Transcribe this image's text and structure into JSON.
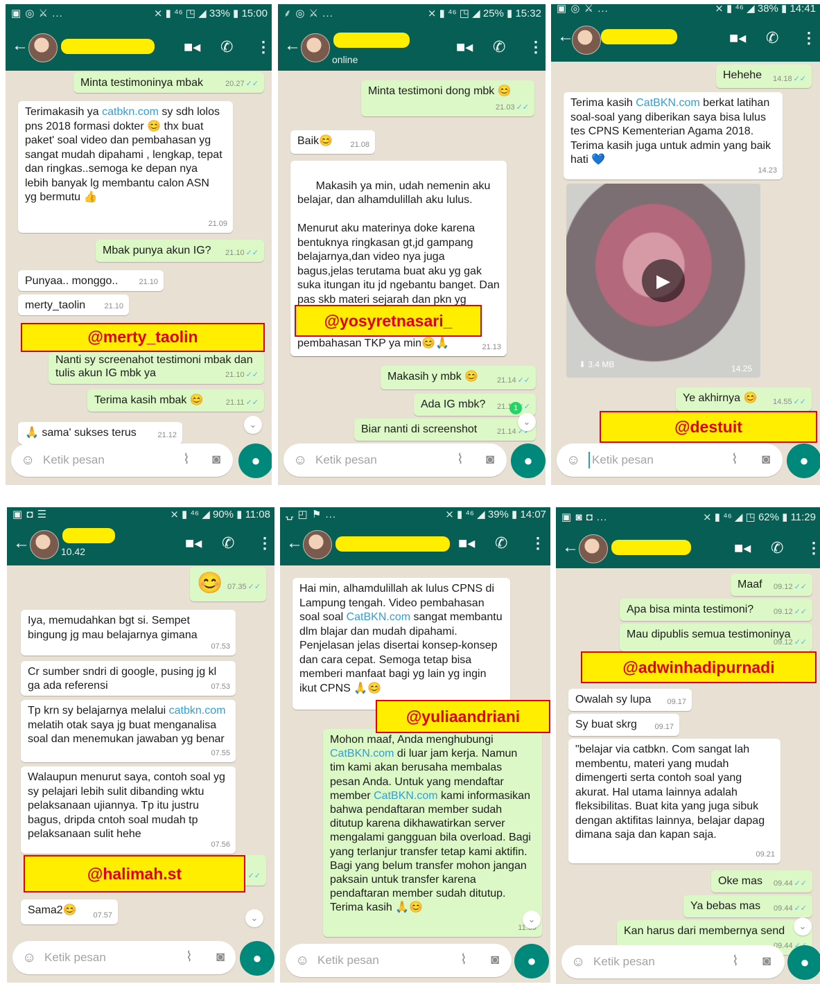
{
  "common": {
    "input_placeholder": "Ketik pesan",
    "icons": {
      "back": "arrow-left-icon",
      "video": "video-call-icon",
      "call": "phone-icon",
      "menu": "more-vert-icon",
      "emoji": "emoji-icon",
      "attach": "paperclip-icon",
      "camera": "camera-icon",
      "mic": "mic-icon",
      "scroll": "chevron-down-icon"
    },
    "colors": {
      "header": "#075e54",
      "chat_bg": "#e8e0d3",
      "outgoing_bubble": "#dcf8c6",
      "incoming_bubble": "#ffffff",
      "label_fill": "#ffee00",
      "label_border": "#e00010",
      "link": "#2f9fd8",
      "read_ticks": "#4fb6ec"
    }
  },
  "screens": [
    {
      "status_left": "▣ ◎ ⚔ ...",
      "status_right": "⨯ ▮ ⁴⁶ ◳ ◢ 33% ▮ 15:00",
      "label": "@merty_taolin",
      "messages": [
        {
          "text": "Minta testimoninya mbak",
          "time": "20.27"
        },
        {
          "pre": "Terimakasih ya ",
          "link": "catbkn.com",
          "post": " sy sdh lolos pns 2018 formasi dokter 😊 thx buat paket' soal video dan pembahasan yg sangat mudah dipahami , lengkap, tepat dan ringkas..semoga ke depan nya lebih banyak lg membantu calon ASN yg bermutu 👍",
          "time": "21.09"
        },
        {
          "text": "Mbak punya akun IG?",
          "time": "21.10"
        },
        {
          "text": "Punyaa.. monggo..",
          "time": "21.10"
        },
        {
          "text": "merty_taolin",
          "time": "21.10"
        },
        {
          "text": "Nanti sy screenahot testimoni mbak dan tulis akun IG mbk ya",
          "time": "21.10"
        },
        {
          "text": "Terima kasih mbak 😊",
          "time": "21.11"
        },
        {
          "text": "🙏 sama' sukses terus",
          "time": "21.12"
        }
      ]
    },
    {
      "status_left": "⸙ ◎ ⚔ ...",
      "status_right": "⨯ ▮ ⁴⁶ ◳ ◢ 25% ▮ 15:32",
      "header_status": "online",
      "label": "@yosyretnasari_",
      "messages": [
        {
          "text": "Minta testimoni dong mbk 😊",
          "time": "21.03"
        },
        {
          "text": "Baik😊",
          "time": "21.08"
        },
        {
          "text": "Makasih ya min, udah nemenin aku belajar, dan alhamdulillah aku lulus.\n\nMenurut aku materinya doke karena bentuknya ringkasan gt,jd gampang belajarnya,dan video nya juga bagus,jelas terutama buat aku yg gak suka itungan itu jd ngebantu banget. Dan pas skb materi sejarah dan pkn yg diringkasan itu keluar.",
          "time": ""
        },
        {
          "text": "pembahasan TKP ya min😊🙏",
          "time": "21.13"
        },
        {
          "text": "Makasih y mbk 😊",
          "time": "21.14"
        },
        {
          "text": "Ada IG mbk?",
          "time": "21.14"
        },
        {
          "text": "Biar nanti di screenshot",
          "time": "21.14"
        }
      ],
      "unread": "1"
    },
    {
      "status_left": "▣ ◎ ⚔ ...",
      "status_right": "⨯ ▮ ⁴⁶ ◢ 38% ▮ 14:41",
      "label": "@destuit",
      "messages": [
        {
          "text": "Hehehe",
          "time": "14.18"
        },
        {
          "pre": "Terima kasih ",
          "link": "CatBKN.com",
          "post": " berkat latihan soal-soal yang diberikan saya bisa lulus tes CPNS Kementerian Agama 2018. Terima kasih juga untuk admin yang baik hati 💙",
          "time": "14.23"
        },
        {
          "video_size": "3.4 MB",
          "time": "14.25"
        },
        {
          "text": "Ye akhirnya 😊",
          "time": "14.55"
        }
      ]
    },
    {
      "status_left": "▣ ◘ ☰",
      "status_right": "⨯ ▮ ⁴⁶ ◢ 90% ▮ 11:08",
      "header_status": "10.42",
      "label": "@halimah.st",
      "messages": [
        {
          "text": "😊",
          "time": "07.35"
        },
        {
          "text": "Iya, memudahkan bgt si. Sempet bingung jg mau belajarnya gimana",
          "time": "07.53"
        },
        {
          "text": "Cr sumber sndri di google, pusing jg kl ga ada referensi",
          "time": "07.53"
        },
        {
          "pre": "Tp krn sy belajarnya melalui ",
          "link": "catbkn.com",
          "post": " melatih otak saya jg buat menganalisa soal dan menemukan jawaban yg benar",
          "time": "07.55"
        },
        {
          "text": "Walaupun menurut saya, contoh soal yg sy pelajari lebih sulit dibanding wktu pelaksanaan ujiannya. Tp itu justru bagus, dripda cntoh soal mudah tp pelaksanaan sulit hehe",
          "time": "07.56"
        },
        {
          "text": "Sama2😊",
          "time": "07.57"
        }
      ]
    },
    {
      "status_left": "⍽ ◰ ⚑ ...",
      "status_right": "⨯ ▮ ⁴⁶ ◢ 39% ▮ 14:07",
      "label": "@yuliaandriani",
      "messages": [
        {
          "pre": "Hai min, alhamdulillah ak lulus CPNS di Lampung tengah. Video pembahasan soal soal ",
          "link": "CatBKN.com",
          "post": " sangat membantu dlm blajar dan mudah dipahami. Penjelasan jelas disertai konsep-konsep dan cara cepat. Semoga tetap bisa memberi manfaat bagi yg lain yg ingin ikut CPNS 🙏😊",
          "time": ""
        },
        {
          "pre": "Mohon maaf, Anda menghubungi ",
          "link": "CatBKN.com",
          "mid": " di luar jam kerja. Namun tim kami akan berusaha membalas pesan Anda. Untuk yang mendaftar member ",
          "link2": "CatBKN.com",
          "post": " kami informasikan bahwa pendaftaran member sudah ditutup karena dikhawatirkan server mengalami gangguan bila overload. Bagi yang terlanjur transfer tetap kami aktifin. Bagi yang belum transfer mohon jangan paksain untuk transfer karena pendaftaran member sudah ditutup. Terima kasih 🙏😊",
          "time": "11.59"
        }
      ]
    },
    {
      "status_left": "▣ ◙ ◘ ...",
      "status_right": "⨯ ▮ ⁴⁶ ◢ ◳ 62% ▮ 11:29",
      "label": "@adwinhadipurnadi",
      "messages": [
        {
          "text": "Maaf",
          "time": "09.12"
        },
        {
          "text": "Apa bisa minta testimoni?",
          "time": "09.12"
        },
        {
          "text": "Mau dipublis semua testimoninya",
          "time": "09.12"
        },
        {
          "text": "Owalah sy lupa",
          "time": "09.17"
        },
        {
          "text": "Sy buat skrg",
          "time": "09.17"
        },
        {
          "text": "\"belajar via catbkn. Com sangat lah membentu, materi yang mudah dimengerti serta contoh soal yang akurat. Hal utama lainnya adalah fleksibilitas. Buat kita yang juga sibuk dengan aktifitas lainnya,  belajar dapag dimana saja dan kapan saja.",
          "time": "09.21"
        },
        {
          "text": "Oke mas",
          "time": "09.44"
        },
        {
          "text": "Ya bebas mas",
          "time": "09.44"
        },
        {
          "text": "Kan harus dari membernya send",
          "time": "09.44"
        }
      ]
    }
  ]
}
